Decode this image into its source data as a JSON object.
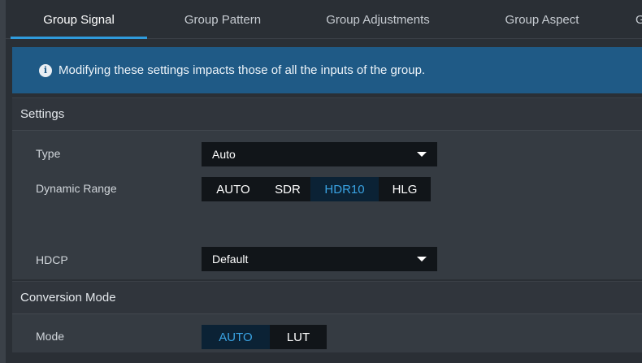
{
  "tabs": [
    {
      "label": "Group Signal",
      "active": true
    },
    {
      "label": "Group Pattern",
      "active": false
    },
    {
      "label": "Group Adjustments",
      "active": false
    },
    {
      "label": "Group Aspect",
      "active": false
    },
    {
      "label": "G",
      "active": false
    }
  ],
  "banner": {
    "icon": "info-icon",
    "icon_glyph": "i",
    "text": "Modifying these settings impacts those of all the inputs of the group."
  },
  "settings": {
    "title": "Settings",
    "type": {
      "label": "Type",
      "value": "Auto"
    },
    "dynamic_range": {
      "label": "Dynamic Range",
      "options": [
        "AUTO",
        "SDR",
        "HDR10",
        "HLG"
      ],
      "selected": "HDR10"
    },
    "hdcp": {
      "label": "HDCP",
      "value": "Default"
    }
  },
  "conversion": {
    "title": "Conversion Mode",
    "mode": {
      "label": "Mode",
      "options": [
        "AUTO",
        "LUT"
      ],
      "selected": "AUTO"
    }
  },
  "colors": {
    "accent": "#2f9bdc",
    "banner": "#1f5a86",
    "selected_text": "#3aa3e3"
  }
}
